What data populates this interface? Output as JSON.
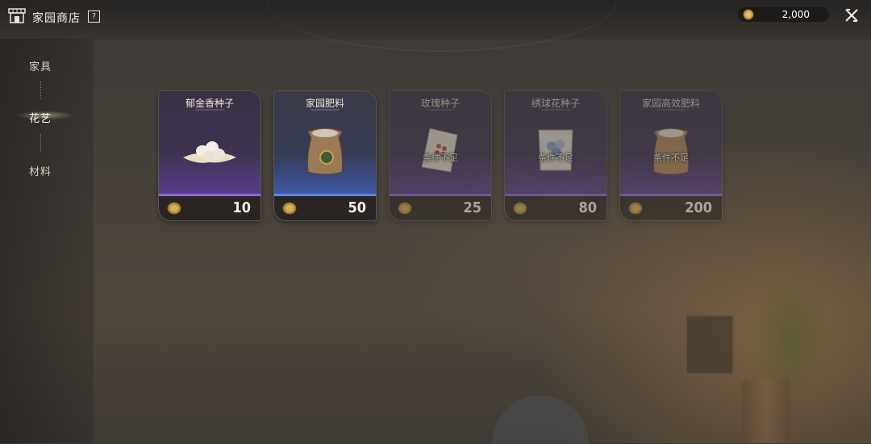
{
  "header": {
    "title": "家园商店",
    "help_icon": "?",
    "icon": "shop-icon"
  },
  "currency": {
    "amount": "2,000",
    "icon": "gold-coin-icon"
  },
  "sidebar": {
    "items": [
      {
        "label": "家具",
        "active": false
      },
      {
        "label": "花艺",
        "active": true
      },
      {
        "label": "材料",
        "active": false
      }
    ]
  },
  "cards": [
    {
      "name": "郁金香种子",
      "price": "10",
      "locked": false,
      "rarity_color": "#7a5fc2",
      "icon": "seed-pile-icon"
    },
    {
      "name": "家园肥料",
      "price": "50",
      "locked": false,
      "rarity_color": "#4d6fc9",
      "icon": "fertilizer-sack-icon"
    },
    {
      "name": "玫瑰种子",
      "price": "25",
      "locked": true,
      "lock_text": "条件不足",
      "rarity_color": "#7a5fc2",
      "icon": "seed-packet-icon"
    },
    {
      "name": "绣球花种子",
      "price": "80",
      "locked": true,
      "lock_text": "条件不足",
      "rarity_color": "#7a5fc2",
      "icon": "seed-packet-icon"
    },
    {
      "name": "家园高效肥料",
      "price": "200",
      "locked": true,
      "lock_text": "条件不足",
      "rarity_color": "#7a5fc2",
      "icon": "fertilizer-sack-icon"
    }
  ]
}
